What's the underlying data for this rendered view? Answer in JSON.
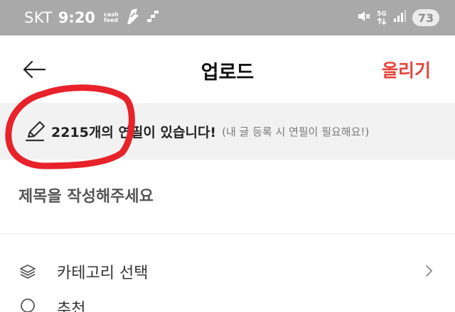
{
  "status_bar": {
    "carrier": "SKT",
    "time": "9:20",
    "cashfeed_line1": "cash",
    "cashfeed_line2": "feed",
    "network": "5G",
    "battery": "73"
  },
  "header": {
    "title": "업로드",
    "upload_label": "올리기"
  },
  "banner": {
    "message": "2215개의 연필이 있습니다!",
    "note": "(내 글 등록 시 연필이 필요해요!)"
  },
  "title_input": {
    "placeholder": "제목을 작성해주세요",
    "value": ""
  },
  "category": {
    "label": "카테고리 선택"
  },
  "next_row": {
    "label": "추천"
  },
  "colors": {
    "accent": "#e5453c",
    "annotation": "#e8222a",
    "status_bar": "#a9a9a9",
    "banner_bg": "#f2f2f2"
  },
  "icons": {
    "back": "arrow-left-icon",
    "pencil": "pencil-icon",
    "layers": "layers-icon",
    "chevron": "chevron-right-icon"
  }
}
